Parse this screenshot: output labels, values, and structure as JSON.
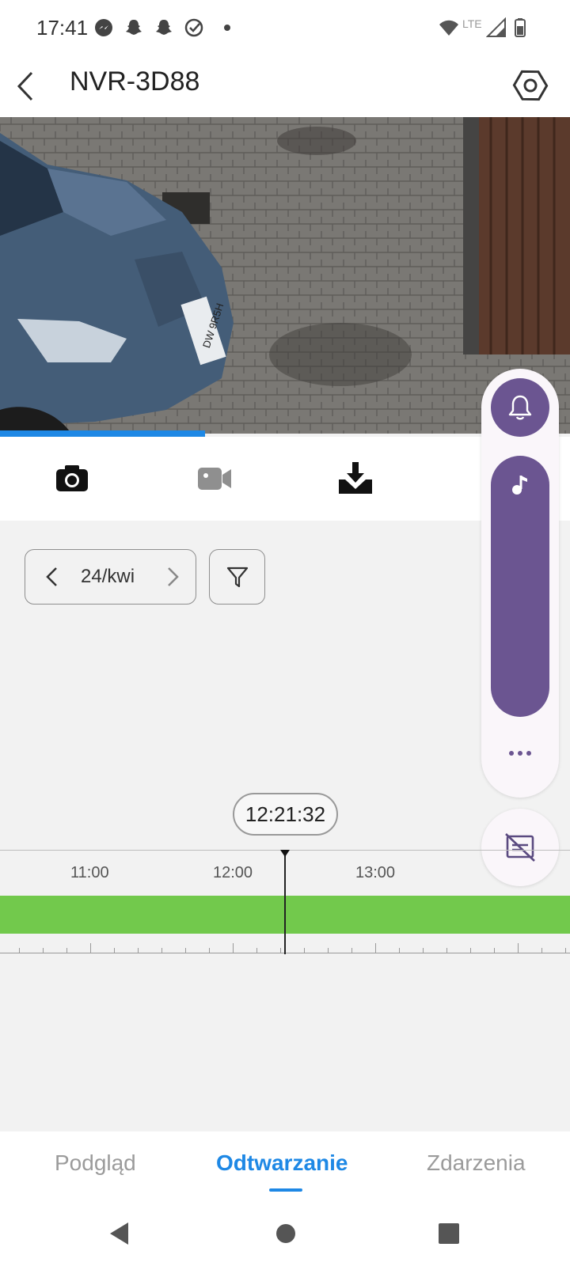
{
  "status_bar": {
    "time": "17:41",
    "network": "LTE",
    "icons": [
      "messenger-icon",
      "snapchat-icon",
      "snapchat-icon",
      "check-circle-icon",
      "dot-icon",
      "wifi-icon",
      "signal-icon",
      "battery-icon"
    ]
  },
  "header": {
    "title": "NVR-3D88",
    "back_icon": "chevron-left-icon",
    "settings_icon": "hexagon-settings-icon"
  },
  "video": {
    "description_icon": "camera-feed",
    "license_plate": "DW 9R5H",
    "playback_progress": 0.36
  },
  "toolbar": {
    "icons": [
      "snapshot-icon",
      "record-video-icon",
      "download-icon"
    ]
  },
  "date_selector": {
    "date": "24/kwi"
  },
  "timeline": {
    "current_time": "12:21:32",
    "tick_labels": [
      "11:00",
      "12:00",
      "13:00"
    ]
  },
  "tabs": {
    "items": [
      "Podgląd",
      "Odtwarzanie",
      "Zdarzenia"
    ],
    "active": "Odtwarzanie"
  },
  "colors": {
    "accent": "#1e88e5",
    "recording": "#72c94c",
    "floating_panel": "#6b5591"
  }
}
